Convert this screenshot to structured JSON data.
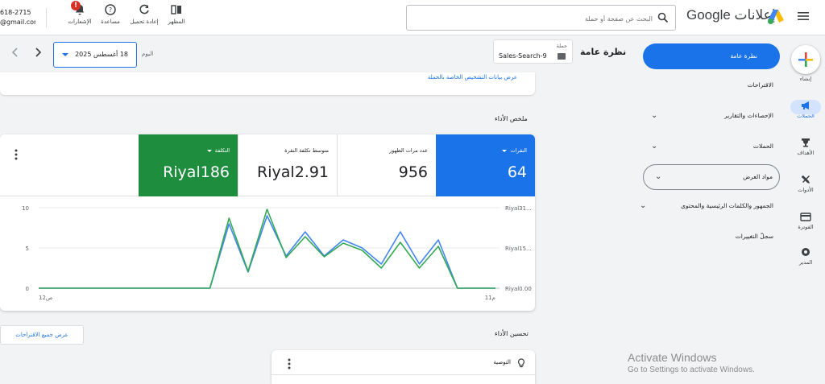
{
  "topbar": {
    "account_line1": "618-2715",
    "account_line2": "@gmail.com",
    "notifications_label": "الإشعارات",
    "notifications_count": "!",
    "help_label": "مساعدة",
    "refresh_label": "إعادة تحميل",
    "appearance_label": "المظهر",
    "search_placeholder": "البحث عن صفحة أو حملة",
    "brand": "Google إعلانات"
  },
  "rail": {
    "create": "إنشاء",
    "campaigns": "الحملات",
    "goals": "الأهداف",
    "tools": "الأدوات",
    "billing": "الفوترة",
    "admin": "المدير"
  },
  "nav": {
    "overview": "نظرة عامة",
    "recommendations": "الاقتراحات",
    "reports": "الإحصاءات والتقارير",
    "campaigns": "الحملات",
    "assets": "مواد العرض",
    "audience": "الجمهور والكلمات الرئيسية والمحتوى",
    "changes": "سجلّ التغييرات"
  },
  "header": {
    "title": "نظرة عامة",
    "campaign_label": "حملة",
    "campaign_name": "Sales-Search-9",
    "today_label": "اليوم",
    "date_value": "18 أغسطس 2025"
  },
  "diagnostics_link": "عرض بيانات التشخيص الخاصة بالحملة",
  "summary": {
    "title": "ملخص الأداء",
    "metrics": [
      {
        "label": "النقرات",
        "value": "64"
      },
      {
        "label": "عدد مرات الظهور",
        "value": "956"
      },
      {
        "label": "متوسط تكلفة النقرة",
        "value": "Riyal2.91"
      },
      {
        "label": "التكلفة",
        "value": "Riyal186"
      }
    ]
  },
  "chart_data": {
    "type": "line",
    "x_start_label": "12ص",
    "x_end_label": "11م",
    "left_axis": {
      "ticks": [
        "10",
        "5",
        "0"
      ],
      "ylim": [
        0,
        10
      ]
    },
    "right_axis": {
      "ticks": [
        "Riyal31...",
        "Riyal15...",
        "Riyal0.00"
      ],
      "ylim": [
        0,
        31
      ]
    },
    "series": [
      {
        "name": "النقرات",
        "color": "#4285f4",
        "values": [
          0,
          0,
          0,
          0,
          0,
          0,
          0,
          0,
          0,
          0,
          8,
          2,
          9,
          4,
          7,
          4,
          6,
          5,
          3,
          7,
          3,
          6,
          0,
          0,
          0
        ]
      },
      {
        "name": "التكلفة",
        "color": "#34a853",
        "values": [
          0,
          0,
          0,
          0,
          0,
          0,
          0,
          0,
          0,
          0,
          8.7,
          2.1,
          9.8,
          3.8,
          6.4,
          3.9,
          5.6,
          4.7,
          2.5,
          5.7,
          2.5,
          5.2,
          0,
          0,
          0
        ]
      }
    ]
  },
  "optimize": {
    "title": "تحسين الأداء",
    "all_recs_button": "عرض جميع الاقتراحات",
    "rec_label": "التوصية"
  },
  "watermark": {
    "title": "Activate Windows",
    "subtitle": "Go to Settings to activate Windows."
  },
  "colors": {
    "blue": "#1a73e8",
    "green": "#1e8e3e"
  }
}
